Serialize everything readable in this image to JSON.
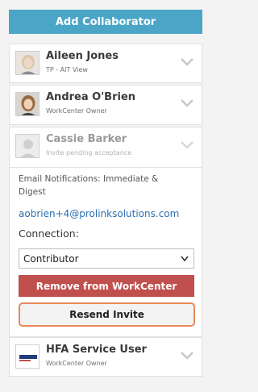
{
  "header": {
    "add_label": "Add Collaborator"
  },
  "collaborators": [
    {
      "name": "Aileen Jones",
      "role": "TP - AIT View"
    },
    {
      "name": "Andrea O'Brien",
      "role": "WorkCenter Owner"
    },
    {
      "name": "Cassie Barker",
      "role": "Invite pending acceptance"
    },
    {
      "name": "HFA Service User",
      "role": "WorkCenter Owner"
    }
  ],
  "details": {
    "notifications": "Email Notifications: Immediate & Digest",
    "email": "aobrien+4@prolinksolutions.com",
    "connection_label": "Connection:",
    "connection_value": "Contributor",
    "remove_label": "Remove from WorkCenter",
    "resend_label": "Resend Invite"
  },
  "colors": {
    "primary": "#4aa5c7",
    "danger": "#c0504d",
    "focus_border": "#e8885a",
    "link": "#2b6fb0"
  }
}
